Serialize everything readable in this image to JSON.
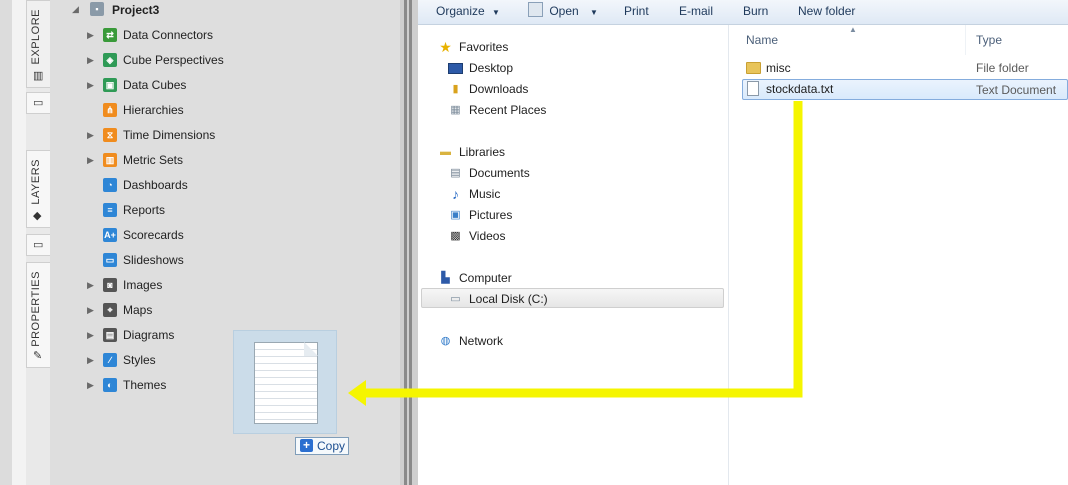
{
  "sidebar_tabs": [
    {
      "label": "EXPLORE"
    },
    {
      "label": "LAYERS"
    },
    {
      "label": "PROPERTIES"
    }
  ],
  "tree": {
    "project": "Project3",
    "items": [
      {
        "label": "Data Connectors",
        "icon": "data-connectors-icon",
        "color": "#3a9a3a",
        "glyph": "⇄",
        "expandable": true
      },
      {
        "label": "Cube Perspectives",
        "icon": "cube-perspectives-icon",
        "color": "#2f9a56",
        "glyph": "◈",
        "expandable": true
      },
      {
        "label": "Data Cubes",
        "icon": "data-cubes-icon",
        "color": "#2f9a56",
        "glyph": "▣",
        "expandable": true
      },
      {
        "label": "Hierarchies",
        "icon": "hierarchies-icon",
        "color": "#f08c1e",
        "glyph": "⋔",
        "expandable": false
      },
      {
        "label": "Time Dimensions",
        "icon": "time-dimensions-icon",
        "color": "#f08c1e",
        "glyph": "⧖",
        "expandable": true
      },
      {
        "label": "Metric Sets",
        "icon": "metric-sets-icon",
        "color": "#f08c1e",
        "glyph": "▥",
        "expandable": true
      },
      {
        "label": "Dashboards",
        "icon": "dashboards-icon",
        "color": "#2e86d6",
        "glyph": "◔",
        "expandable": false
      },
      {
        "label": "Reports",
        "icon": "reports-icon",
        "color": "#2e86d6",
        "glyph": "≡",
        "expandable": false
      },
      {
        "label": "Scorecards",
        "icon": "scorecards-icon",
        "color": "#2e86d6",
        "glyph": "A+",
        "expandable": false
      },
      {
        "label": "Slideshows",
        "icon": "slideshows-icon",
        "color": "#2e86d6",
        "glyph": "▭",
        "expandable": false
      },
      {
        "label": "Images",
        "icon": "images-icon",
        "color": "#555555",
        "glyph": "◙",
        "expandable": true
      },
      {
        "label": "Maps",
        "icon": "maps-icon",
        "color": "#555555",
        "glyph": "⌖",
        "expandable": true
      },
      {
        "label": "Diagrams",
        "icon": "diagrams-icon",
        "color": "#555555",
        "glyph": "▤",
        "expandable": true
      },
      {
        "label": "Styles",
        "icon": "styles-icon",
        "color": "#2e86d6",
        "glyph": "∕",
        "expandable": true
      },
      {
        "label": "Themes",
        "icon": "themes-icon",
        "color": "#2e86d6",
        "glyph": "◐",
        "expandable": true
      }
    ]
  },
  "drag": {
    "copy_label": "Copy",
    "accent": "#f5f500"
  },
  "toolbar": {
    "organize": "Organize",
    "open": "Open",
    "print": "Print",
    "email": "E-mail",
    "burn": "Burn",
    "new_folder": "New folder"
  },
  "nav": {
    "favorites": "Favorites",
    "desktop": "Desktop",
    "downloads": "Downloads",
    "recent_places": "Recent Places",
    "libraries": "Libraries",
    "documents": "Documents",
    "music": "Music",
    "pictures": "Pictures",
    "videos": "Videos",
    "computer": "Computer",
    "local_disk": "Local Disk (C:)",
    "network": "Network"
  },
  "files": {
    "col_name": "Name",
    "col_type": "Type",
    "rows": [
      {
        "name": "misc",
        "type": "File folder"
      },
      {
        "name": "stockdata.txt",
        "type": "Text Document"
      }
    ]
  }
}
